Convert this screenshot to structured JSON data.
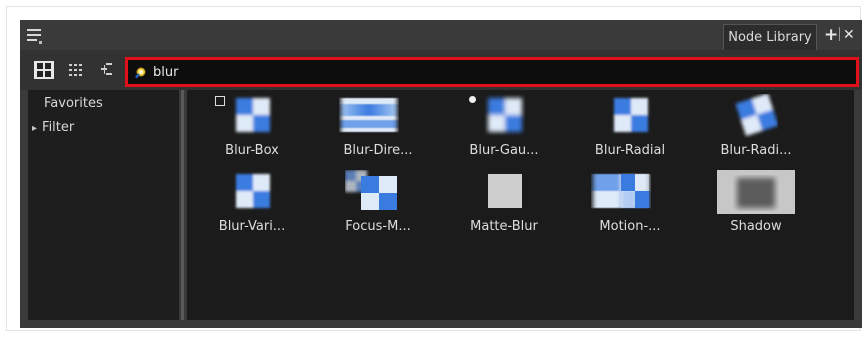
{
  "window": {
    "tab_label": "Node Library",
    "add_label": "+",
    "close_label": "✕"
  },
  "toolbar": {
    "search_value": "blur",
    "search_placeholder": ""
  },
  "sidebar": {
    "items": [
      {
        "label": "Favorites",
        "expandable": false
      },
      {
        "label": "Filter",
        "expandable": true,
        "arrow": "▸"
      }
    ]
  },
  "nodes": [
    {
      "label": "Blur-Box",
      "icon": "blur-box-icon"
    },
    {
      "label": "Blur-Dire...",
      "icon": "blur-directional-icon"
    },
    {
      "label": "Blur-Gau...",
      "icon": "blur-gaussian-icon"
    },
    {
      "label": "Blur-Radial",
      "icon": "blur-radial-icon"
    },
    {
      "label": "Blur-Radi...",
      "icon": "blur-radial-zoom-icon"
    },
    {
      "label": "Blur-Vari...",
      "icon": "blur-variable-icon"
    },
    {
      "label": "Focus-M...",
      "icon": "focus-multiplier-icon"
    },
    {
      "label": "Matte-Blur",
      "icon": "matte-blur-icon"
    },
    {
      "label": "Motion-...",
      "icon": "motion-blur-icon"
    },
    {
      "label": "Shadow",
      "icon": "shadow-icon"
    }
  ],
  "colors": {
    "search_highlight": "#e0111b",
    "thumb_blue": "#3a7be0",
    "thumb_light": "#dfeaf8"
  }
}
